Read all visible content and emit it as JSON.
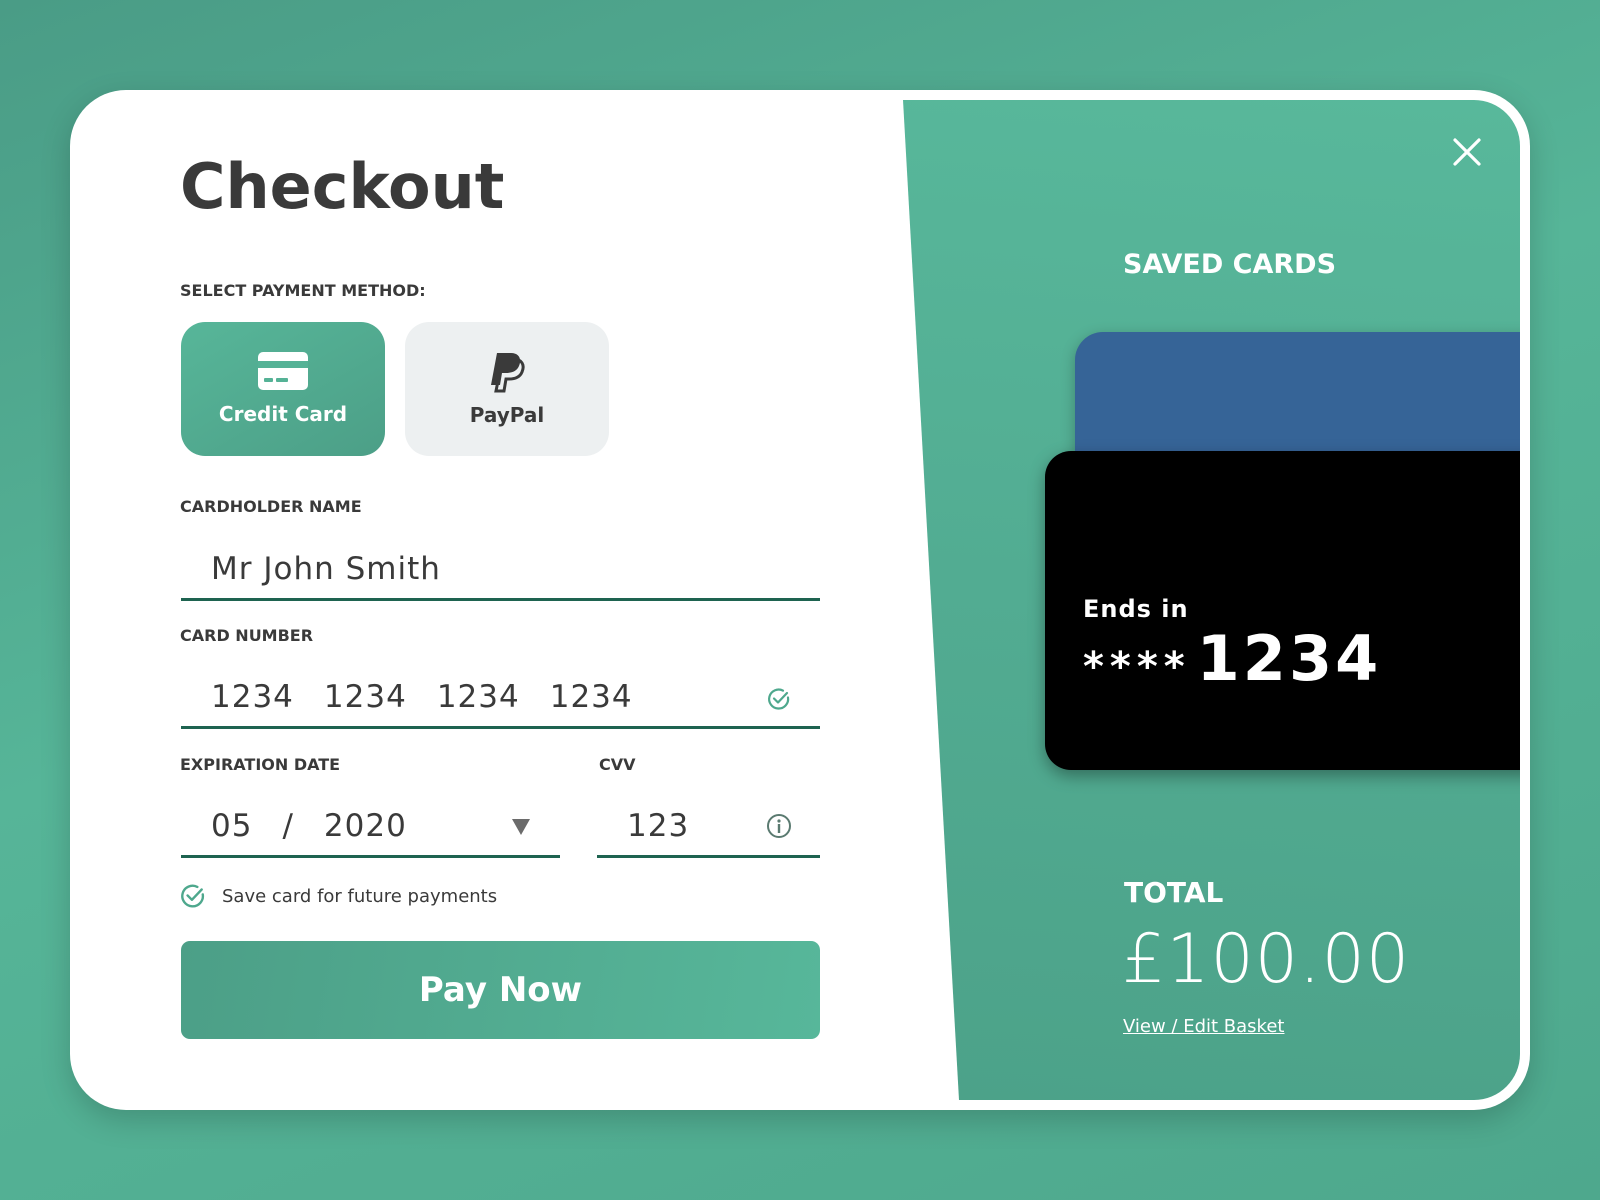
{
  "checkout": {
    "title": "Checkout",
    "payment_method_label": "SELECT PAYMENT METHOD:",
    "payment_methods": [
      {
        "label": "Credit Card",
        "icon": "credit-card-icon",
        "selected": true
      },
      {
        "label": "PayPal",
        "icon": "paypal-icon",
        "selected": false
      }
    ],
    "cardholder": {
      "label": "CARDHOLDER NAME",
      "value": "Mr John Smith"
    },
    "card_number": {
      "label": "CARD NUMBER",
      "groups": [
        "1234",
        "1234",
        "1234",
        "1234"
      ],
      "status_icon": "check-circle-icon"
    },
    "expiration": {
      "label": "EXPIRATION DATE",
      "month": "05",
      "separator": "/",
      "year": "2020",
      "dropdown_icon": "triangle-down-icon"
    },
    "cvv": {
      "label": "CVV",
      "value": "123",
      "info_icon": "info-circle-icon"
    },
    "save_card": {
      "label": "Save card for future payments",
      "checked": true
    },
    "pay_button": "Pay Now"
  },
  "summary": {
    "close_icon": "close-icon",
    "saved_cards_title": "SAVED CARDS",
    "saved_cards": [
      {
        "color": "#366497"
      },
      {
        "color": "#000000",
        "ends_in_label": "Ends in",
        "mask": "****",
        "last4": "1234"
      }
    ],
    "total_label": "TOTAL",
    "total_value": "£100.00",
    "basket_link": "View / Edit Basket"
  },
  "colors": {
    "accent": "#52ac92",
    "underline": "#1e6350",
    "text": "#3a3a3a"
  }
}
